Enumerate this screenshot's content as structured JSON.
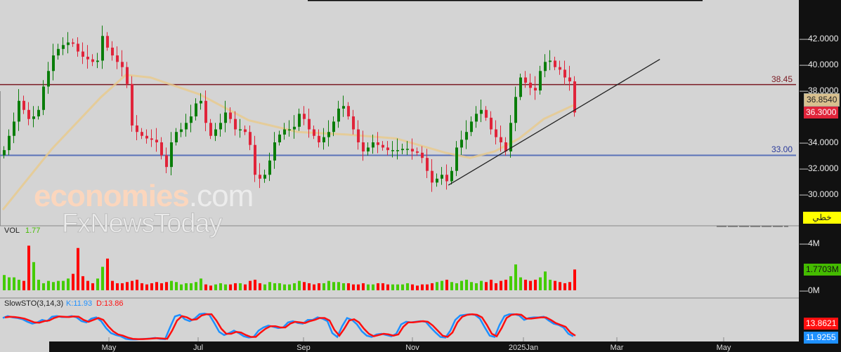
{
  "watermark": {
    "line1a": "economies",
    "line1b": ".com",
    "line2": "FxNewsToday"
  },
  "levels": {
    "resistance": "38.45",
    "support": "33.00"
  },
  "axis_tags": {
    "ma": "36.8540",
    "last": "36.3000",
    "mode": "خطي",
    "volume": "1.7703M",
    "d": "13.8621",
    "k": "11.9255"
  },
  "volume_pane": {
    "title": "VOL",
    "value": "1.77"
  },
  "stoch_pane": {
    "title": "SlowSTO(3,14,3)",
    "k": "K:11.93",
    "d": "D:13.86"
  },
  "colors": {
    "up": "#0a7d0a",
    "down": "#e0243a",
    "ma": "#e8c98a",
    "resistance": "#7a1a22",
    "support": "#5a72b8",
    "k": "#1e90ff",
    "d": "#ff1010",
    "vol_up": "#44cc00",
    "vol_down": "#ff0000"
  },
  "chart_data": {
    "type": "candlestick",
    "price_axis": {
      "ticks": [
        "42.0000",
        "40.0000",
        "38.0000",
        "34.0000",
        "32.0000",
        "30.0000"
      ],
      "range": [
        28.0,
        44.5
      ]
    },
    "volume_axis": {
      "ticks": [
        "4M",
        "0M"
      ]
    },
    "x_ticks": [
      "May",
      "Jul",
      "Sep",
      "Nov",
      "2025Jan",
      "Mar",
      "May"
    ],
    "closes": [
      33.4,
      34.5,
      35.6,
      37.2,
      36.5,
      35.8,
      36,
      36.5,
      38.3,
      39.5,
      40.7,
      41.2,
      41.5,
      41.7,
      41.6,
      41,
      40.6,
      40.4,
      40.2,
      40.3,
      42.2,
      41.3,
      40.7,
      40.2,
      39.8,
      38.5,
      35.3,
      34.8,
      34.5,
      34.3,
      34.2,
      34,
      33,
      32.1,
      34,
      34.8,
      35,
      35.5,
      36,
      37,
      37.2,
      35.5,
      34.5,
      35,
      35.5,
      36.3,
      35.8,
      35,
      35,
      34.8,
      33.8,
      31.5,
      31.2,
      31.5,
      32.6,
      34,
      34.6,
      35,
      35,
      35.2,
      36.2,
      35.8,
      35,
      34.5,
      34,
      34.4,
      34.8,
      35.6,
      36.6,
      36.8,
      36,
      35,
      34,
      33.3,
      33.6,
      34,
      33.8,
      33.6,
      33.4,
      33.4,
      33.4,
      33.5,
      33.5,
      33.3,
      33.2,
      32.8,
      31.8,
      30.9,
      31.2,
      31.5,
      31,
      31.8,
      33.6,
      34.2,
      34.8,
      35.6,
      36.2,
      36.5,
      35.9,
      35,
      34.4,
      34,
      33.3,
      35.5,
      37.5,
      39,
      38.6,
      38.2,
      38,
      39.5,
      40.2,
      40.3,
      39.8,
      39.6,
      39,
      38.7,
      36.3
    ],
    "ma": [
      [
        0,
        28.8
      ],
      [
        10,
        33.5
      ],
      [
        20,
        37.5
      ],
      [
        25,
        39.2
      ],
      [
        30,
        39.0
      ],
      [
        40,
        37.7
      ],
      [
        50,
        35.7
      ],
      [
        60,
        34.8
      ],
      [
        70,
        34.6
      ],
      [
        80,
        34.3
      ],
      [
        90,
        33.2
      ],
      [
        95,
        32.8
      ],
      [
        100,
        33.3
      ],
      [
        105,
        34.3
      ],
      [
        110,
        35.8
      ],
      [
        116,
        36.854
      ]
    ],
    "volume": [
      1.3,
      1.1,
      1.1,
      0.9,
      0.8,
      3.8,
      2.4,
      0.9,
      0.6,
      0.8,
      0.7,
      0.8,
      0.8,
      1.0,
      1.4,
      3.6,
      1.2,
      0.8,
      0.6,
      1.0,
      2.0,
      2.7,
      0.8,
      0.6,
      0.6,
      0.7,
      0.8,
      0.9,
      0.6,
      0.5,
      0.6,
      0.7,
      0.6,
      0.7,
      0.8,
      0.7,
      0.5,
      0.6,
      0.6,
      0.7,
      1.0,
      0.5,
      0.4,
      0.5,
      0.6,
      0.5,
      0.5,
      0.6,
      0.6,
      0.5,
      0.8,
      0.9,
      0.6,
      0.5,
      0.7,
      0.6,
      0.6,
      0.5,
      0.5,
      0.6,
      0.8,
      0.7,
      0.6,
      0.5,
      0.6,
      0.6,
      0.8,
      0.7,
      0.7,
      0.6,
      0.6,
      0.5,
      0.5,
      0.6,
      0.5,
      0.5,
      0.6,
      0.6,
      0.5,
      0.5,
      0.5,
      0.5,
      0.6,
      0.5,
      0.4,
      0.5,
      0.5,
      0.6,
      0.7,
      0.8,
      0.9,
      0.7,
      0.6,
      0.8,
      0.9,
      0.7,
      0.6,
      0.8,
      0.7,
      0.9,
      0.6,
      0.8,
      0.9,
      1.2,
      2.2,
      1.1,
      0.9,
      0.8,
      0.9,
      1.1,
      1.6,
      0.9,
      0.8,
      0.7,
      0.6,
      0.7,
      1.7703
    ],
    "stoch_k": [
      70,
      76,
      72,
      70,
      66,
      58,
      52,
      56,
      64,
      60,
      74,
      76,
      73,
      73,
      76,
      72,
      60,
      56,
      68,
      72,
      60,
      38,
      22,
      16,
      12,
      4,
      2,
      2,
      3,
      4,
      5,
      7,
      4,
      3,
      40,
      75,
      80,
      66,
      60,
      68,
      82,
      84,
      80,
      54,
      26,
      16,
      22,
      30,
      22,
      12,
      8,
      10,
      30,
      40,
      46,
      42,
      38,
      40,
      56,
      60,
      54,
      52,
      64,
      64,
      72,
      68,
      60,
      22,
      10,
      44,
      70,
      64,
      50,
      28,
      14,
      10,
      18,
      20,
      16,
      12,
      20,
      50,
      58,
      56,
      58,
      60,
      58,
      40,
      24,
      10,
      8,
      30,
      64,
      78,
      80,
      82,
      80,
      68,
      40,
      14,
      10,
      48,
      76,
      82,
      82,
      78,
      64,
      70,
      72,
      72,
      74,
      62,
      52,
      48,
      40,
      20,
      11.93
    ],
    "stoch_d": [
      72,
      74,
      73,
      71,
      68,
      62,
      56,
      55,
      60,
      62,
      70,
      75,
      74,
      73,
      75,
      74,
      64,
      58,
      64,
      70,
      64,
      44,
      28,
      18,
      14,
      8,
      4,
      3,
      3,
      4,
      5,
      6,
      5,
      4,
      30,
      62,
      76,
      72,
      64,
      66,
      78,
      82,
      82,
      62,
      36,
      20,
      20,
      26,
      24,
      16,
      10,
      10,
      24,
      36,
      44,
      44,
      40,
      40,
      52,
      58,
      56,
      54,
      60,
      64,
      70,
      70,
      62,
      32,
      14,
      36,
      62,
      66,
      56,
      36,
      20,
      12,
      16,
      20,
      18,
      14,
      18,
      42,
      56,
      56,
      58,
      60,
      58,
      46,
      30,
      14,
      10,
      24,
      56,
      74,
      80,
      82,
      80,
      72,
      48,
      20,
      12,
      38,
      70,
      80,
      82,
      80,
      68,
      68,
      70,
      72,
      72,
      64,
      54,
      48,
      42,
      24,
      13.86
    ],
    "trendline": {
      "from": {
        "index": 90.6,
        "price": 30.7
      },
      "to": {
        "index": 133.6,
        "price": 40.4
      }
    },
    "resistance": 38.45,
    "support": 33.0,
    "last_price": 36.3,
    "ma_last": 36.854,
    "volume_last_m": 1.7703,
    "k_last": 11.9255,
    "d_last": 13.8621
  }
}
